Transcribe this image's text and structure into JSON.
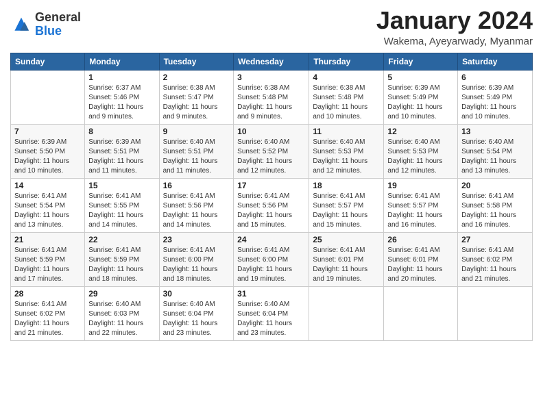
{
  "header": {
    "logo": {
      "general": "General",
      "blue": "Blue"
    },
    "title": "January 2024",
    "subtitle": "Wakema, Ayeyarwady, Myanmar"
  },
  "weekdays": [
    "Sunday",
    "Monday",
    "Tuesday",
    "Wednesday",
    "Thursday",
    "Friday",
    "Saturday"
  ],
  "weeks": [
    [
      {
        "day": "",
        "sunrise": "",
        "sunset": "",
        "daylight": ""
      },
      {
        "day": "1",
        "sunrise": "Sunrise: 6:37 AM",
        "sunset": "Sunset: 5:46 PM",
        "daylight": "Daylight: 11 hours and 9 minutes."
      },
      {
        "day": "2",
        "sunrise": "Sunrise: 6:38 AM",
        "sunset": "Sunset: 5:47 PM",
        "daylight": "Daylight: 11 hours and 9 minutes."
      },
      {
        "day": "3",
        "sunrise": "Sunrise: 6:38 AM",
        "sunset": "Sunset: 5:48 PM",
        "daylight": "Daylight: 11 hours and 9 minutes."
      },
      {
        "day": "4",
        "sunrise": "Sunrise: 6:38 AM",
        "sunset": "Sunset: 5:48 PM",
        "daylight": "Daylight: 11 hours and 10 minutes."
      },
      {
        "day": "5",
        "sunrise": "Sunrise: 6:39 AM",
        "sunset": "Sunset: 5:49 PM",
        "daylight": "Daylight: 11 hours and 10 minutes."
      },
      {
        "day": "6",
        "sunrise": "Sunrise: 6:39 AM",
        "sunset": "Sunset: 5:49 PM",
        "daylight": "Daylight: 11 hours and 10 minutes."
      }
    ],
    [
      {
        "day": "7",
        "sunrise": "Sunrise: 6:39 AM",
        "sunset": "Sunset: 5:50 PM",
        "daylight": "Daylight: 11 hours and 10 minutes."
      },
      {
        "day": "8",
        "sunrise": "Sunrise: 6:39 AM",
        "sunset": "Sunset: 5:51 PM",
        "daylight": "Daylight: 11 hours and 11 minutes."
      },
      {
        "day": "9",
        "sunrise": "Sunrise: 6:40 AM",
        "sunset": "Sunset: 5:51 PM",
        "daylight": "Daylight: 11 hours and 11 minutes."
      },
      {
        "day": "10",
        "sunrise": "Sunrise: 6:40 AM",
        "sunset": "Sunset: 5:52 PM",
        "daylight": "Daylight: 11 hours and 12 minutes."
      },
      {
        "day": "11",
        "sunrise": "Sunrise: 6:40 AM",
        "sunset": "Sunset: 5:53 PM",
        "daylight": "Daylight: 11 hours and 12 minutes."
      },
      {
        "day": "12",
        "sunrise": "Sunrise: 6:40 AM",
        "sunset": "Sunset: 5:53 PM",
        "daylight": "Daylight: 11 hours and 12 minutes."
      },
      {
        "day": "13",
        "sunrise": "Sunrise: 6:40 AM",
        "sunset": "Sunset: 5:54 PM",
        "daylight": "Daylight: 11 hours and 13 minutes."
      }
    ],
    [
      {
        "day": "14",
        "sunrise": "Sunrise: 6:41 AM",
        "sunset": "Sunset: 5:54 PM",
        "daylight": "Daylight: 11 hours and 13 minutes."
      },
      {
        "day": "15",
        "sunrise": "Sunrise: 6:41 AM",
        "sunset": "Sunset: 5:55 PM",
        "daylight": "Daylight: 11 hours and 14 minutes."
      },
      {
        "day": "16",
        "sunrise": "Sunrise: 6:41 AM",
        "sunset": "Sunset: 5:56 PM",
        "daylight": "Daylight: 11 hours and 14 minutes."
      },
      {
        "day": "17",
        "sunrise": "Sunrise: 6:41 AM",
        "sunset": "Sunset: 5:56 PM",
        "daylight": "Daylight: 11 hours and 15 minutes."
      },
      {
        "day": "18",
        "sunrise": "Sunrise: 6:41 AM",
        "sunset": "Sunset: 5:57 PM",
        "daylight": "Daylight: 11 hours and 15 minutes."
      },
      {
        "day": "19",
        "sunrise": "Sunrise: 6:41 AM",
        "sunset": "Sunset: 5:57 PM",
        "daylight": "Daylight: 11 hours and 16 minutes."
      },
      {
        "day": "20",
        "sunrise": "Sunrise: 6:41 AM",
        "sunset": "Sunset: 5:58 PM",
        "daylight": "Daylight: 11 hours and 16 minutes."
      }
    ],
    [
      {
        "day": "21",
        "sunrise": "Sunrise: 6:41 AM",
        "sunset": "Sunset: 5:59 PM",
        "daylight": "Daylight: 11 hours and 17 minutes."
      },
      {
        "day": "22",
        "sunrise": "Sunrise: 6:41 AM",
        "sunset": "Sunset: 5:59 PM",
        "daylight": "Daylight: 11 hours and 18 minutes."
      },
      {
        "day": "23",
        "sunrise": "Sunrise: 6:41 AM",
        "sunset": "Sunset: 6:00 PM",
        "daylight": "Daylight: 11 hours and 18 minutes."
      },
      {
        "day": "24",
        "sunrise": "Sunrise: 6:41 AM",
        "sunset": "Sunset: 6:00 PM",
        "daylight": "Daylight: 11 hours and 19 minutes."
      },
      {
        "day": "25",
        "sunrise": "Sunrise: 6:41 AM",
        "sunset": "Sunset: 6:01 PM",
        "daylight": "Daylight: 11 hours and 19 minutes."
      },
      {
        "day": "26",
        "sunrise": "Sunrise: 6:41 AM",
        "sunset": "Sunset: 6:01 PM",
        "daylight": "Daylight: 11 hours and 20 minutes."
      },
      {
        "day": "27",
        "sunrise": "Sunrise: 6:41 AM",
        "sunset": "Sunset: 6:02 PM",
        "daylight": "Daylight: 11 hours and 21 minutes."
      }
    ],
    [
      {
        "day": "28",
        "sunrise": "Sunrise: 6:41 AM",
        "sunset": "Sunset: 6:02 PM",
        "daylight": "Daylight: 11 hours and 21 minutes."
      },
      {
        "day": "29",
        "sunrise": "Sunrise: 6:40 AM",
        "sunset": "Sunset: 6:03 PM",
        "daylight": "Daylight: 11 hours and 22 minutes."
      },
      {
        "day": "30",
        "sunrise": "Sunrise: 6:40 AM",
        "sunset": "Sunset: 6:04 PM",
        "daylight": "Daylight: 11 hours and 23 minutes."
      },
      {
        "day": "31",
        "sunrise": "Sunrise: 6:40 AM",
        "sunset": "Sunset: 6:04 PM",
        "daylight": "Daylight: 11 hours and 23 minutes."
      },
      {
        "day": "",
        "sunrise": "",
        "sunset": "",
        "daylight": ""
      },
      {
        "day": "",
        "sunrise": "",
        "sunset": "",
        "daylight": ""
      },
      {
        "day": "",
        "sunrise": "",
        "sunset": "",
        "daylight": ""
      }
    ]
  ]
}
